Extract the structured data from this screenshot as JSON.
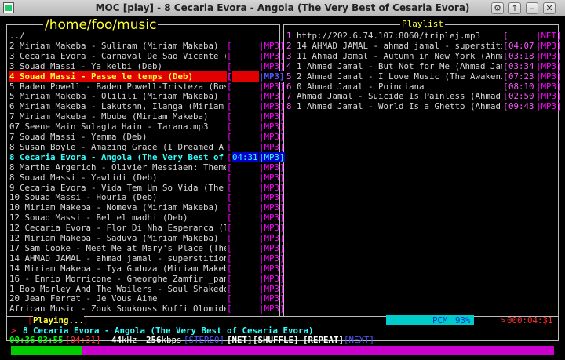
{
  "window": {
    "title": "MOC [play] - 8 Cecaria Evora - Angola (The Very Best of Cesaria Evora)"
  },
  "browser": {
    "path": "/home/foo/music",
    "parent": "../",
    "files": [
      {
        "title": "2 Miriam Makeba - Suliram (Miriam Makeba)",
        "time": "",
        "fmt": "MP3"
      },
      {
        "title": "3 Cecaria Evora - Carnaval De Sao Vicente (The",
        "time": "",
        "fmt": "MP3"
      },
      {
        "title": "3 Souad Massi - Ya kelbi (Deb)",
        "time": "",
        "fmt": "MP3"
      },
      {
        "title": "4 Souad Massi - Passe le temps (Deb)",
        "time": "",
        "fmt": "MP3",
        "state": "selected"
      },
      {
        "title": "5 Baden Powell - Baden Powell-Tristeza (Bossa",
        "time": "",
        "fmt": "MP3"
      },
      {
        "title": "5 Miriam Makeba - Olilili (Miriam Makeba)",
        "time": "",
        "fmt": "MP3"
      },
      {
        "title": "6 Miriam Makeba - Lakutshn, Ilanga (Miriam Mak",
        "time": "",
        "fmt": "MP3"
      },
      {
        "title": "7 Miriam Makeba - Mbube (Miriam Makeba)",
        "time": "",
        "fmt": "MP3"
      },
      {
        "title": "07 Seene Main Sulagta Hain - Tarana.mp3",
        "time": "",
        "fmt": "MP3"
      },
      {
        "title": "7 Souad Massi - Yemma (Deb)",
        "time": "",
        "fmt": "MP3"
      },
      {
        "title": "8 Susan Boyle - Amazing Grace (I Dreamed A Dre",
        "time": "",
        "fmt": "MP3"
      },
      {
        "title": "8 Cecaria Evora - Angola (The Very Best of Ces",
        "time": "04:31",
        "fmt": "MP3",
        "state": "playing"
      },
      {
        "title": "8 Martha Argerich - Olivier Messiaen: Theme an",
        "time": "",
        "fmt": "MP3"
      },
      {
        "title": "8 Souad Massi - Yawlidi (Deb)",
        "time": "",
        "fmt": "MP3"
      },
      {
        "title": "9 Cecaria Evora - Vida Tem Um So Vida (The Ver",
        "time": "",
        "fmt": "MP3"
      },
      {
        "title": "10 Souad Massi - Houria (Deb)",
        "time": "",
        "fmt": "MP3"
      },
      {
        "title": "10 Miriam Makeba - Nomeva (Miriam Makeba)",
        "time": "",
        "fmt": "MP3"
      },
      {
        "title": "12 Souad Massi - Bel el madhi (Deb)",
        "time": "",
        "fmt": "MP3"
      },
      {
        "title": "12 Cecaria Evora - Flor Di Nha Esperanca (The",
        "time": "",
        "fmt": "MP3"
      },
      {
        "title": "12 Miriam Makeba - Saduva (Miriam Makeba)",
        "time": "",
        "fmt": "MP3"
      },
      {
        "title": "17 Sam Cooke - Meet Me at Mary's Place (The Be",
        "time": "",
        "fmt": "MP3"
      },
      {
        "title": "14 AHMAD JAMAL - ahmad jamal - superstition (s",
        "time": "",
        "fmt": "MP3"
      },
      {
        "title": "14 Miriam Makeba - Iya Guduza (Miriam Makeba)",
        "time": "",
        "fmt": "MP3"
      },
      {
        "title": "16 - Ennio Morricone - Gheorghe Zamfir _pan fl",
        "time": "",
        "fmt": "MP3"
      },
      {
        "title": "1 Bob Marley And The Wailers - Soul Shakedown",
        "time": "",
        "fmt": "MP3"
      },
      {
        "title": "20 Jean Ferrat - Je Vous Aime",
        "time": "",
        "fmt": "MP3"
      },
      {
        "title": "African Music - Zouk Soukouss Koffi Olomide _",
        "time": "",
        "fmt": "MP3"
      }
    ]
  },
  "playlist": {
    "title": "Playlist",
    "items": [
      {
        "num": "1",
        "title": "http://202.6.74.107:8060/triplej.mp3",
        "time": "",
        "fmt": "NET"
      },
      {
        "num": "2",
        "title": "14 AHMAD JAMAL - ahmad jamal - superstition",
        "time": "04:07",
        "fmt": "MP3"
      },
      {
        "num": "3",
        "title": "11 Ahmad Jamal - Autumn in New York (Ahmad J",
        "time": "03:18",
        "fmt": "MP3"
      },
      {
        "num": "4",
        "title": "1 Ahmad Jamal - But Not for Me (Ahmad Jamal",
        "time": "03:34",
        "fmt": "MP3"
      },
      {
        "num": "5",
        "title": "2 Ahmad Jamal - I Love Music (The Awakening)",
        "time": "07:23",
        "fmt": "MP3"
      },
      {
        "num": "6",
        "title": "0 Ahmad Jamal - Poinciana",
        "time": "08:10",
        "fmt": "MP3"
      },
      {
        "num": "7",
        "title": "Ahmad Jamal - Suicide Is Painless (Ahmad Jam",
        "time": "02:50",
        "fmt": "MP3"
      },
      {
        "num": "8",
        "title": "1 Ahmad Jamal - World Is a Ghetto (Ahmad Jam",
        "time": "09:43",
        "fmt": "MP3"
      }
    ]
  },
  "status": {
    "state": "Playing...",
    "mixer_label": "PCM",
    "mixer_value": "93%",
    "mixer_level": 0.93,
    "total_time": "000:04:31",
    "now_playing": "8 Cecaria Evora - Angola (The Very Best of Cesaria Evora)",
    "elapsed": "00:36",
    "remaining": "03:55",
    "total": "04:31",
    "rate": "44",
    "rate_unit": "kHz",
    "bitrate": "256",
    "bitrate_unit": "kbps",
    "flags": {
      "stereo": "STEREO",
      "net": "NET",
      "shuffle": "SHUFFLE",
      "repeat": "REPEAT",
      "next": "NEXT"
    },
    "progress": 0.13
  },
  "colors": {
    "accent": "#ff00ff",
    "selected": "#e00000",
    "playing": "#33ffff",
    "title": "#ffff33",
    "progress_done": "#00cc00",
    "progress_rest": "#cc00cc",
    "mixer": "#00cccc"
  },
  "icons": {
    "app": "moc-icon",
    "window_buttons": [
      "menu-icon",
      "maximize-icon",
      "minimize-icon",
      "close-icon"
    ]
  }
}
